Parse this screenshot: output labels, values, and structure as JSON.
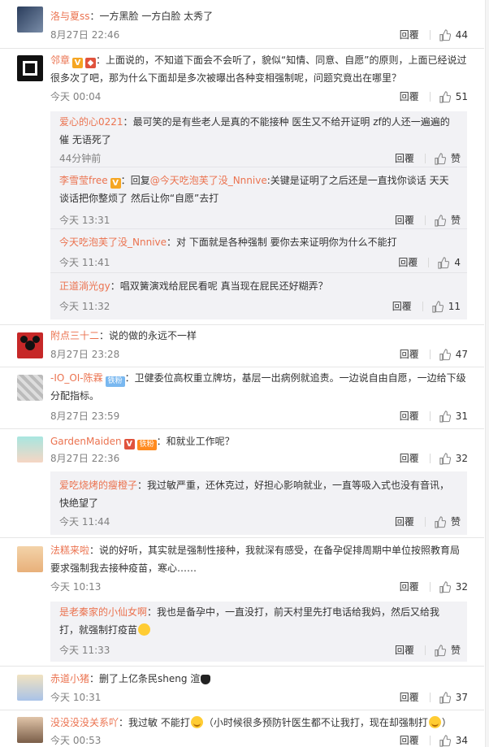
{
  "ui": {
    "reply_label": "回覆",
    "like_icon": "thumbs-up-icon",
    "accent_name_color": "#eb7350"
  },
  "comments": [
    {
      "user": "洛与夏ss",
      "colon": "：",
      "text": "一方黑脸  一方白脸  太秀了",
      "time": "8月27日 22:46",
      "likes": "44"
    },
    {
      "user": "邻章",
      "colon": "：",
      "text": "上面说的，不知道下面会不会听了，貌似“知情、同意、自愿”的原则，上面已经说过很多次了吧，那为什么下面却是多次被曝出各种变相强制呢，问题究竟出在哪里？",
      "time": "今天 00:04",
      "likes": "51",
      "replies": [
        {
          "user": "爱心的心0221",
          "colon": "：",
          "text": "最可笑的是有些老人是真的不能接种 医生又不给开证明 zf的人还一遍遍的催 无语死了",
          "time": "44分钟前",
          "likes": "赞"
        },
        {
          "user": "李雪莹free",
          "colon": "：",
          "prefix": "回复",
          "mention": "@今天吃泡芙了没_Nnnive",
          "text": ":关键是证明了之后还是一直找你谈话 天天谈话把你整烦了 然后让你“自愿”去打",
          "time": "今天 13:31",
          "likes": "赞"
        },
        {
          "user": "今天吃泡芙了没_Nnnive",
          "colon": "：",
          "text": "对  下面就是各种强制  要你去来证明你为什么不能打",
          "time": "今天 11:41",
          "likes": "4"
        },
        {
          "user": "正道淌光gy",
          "colon": "：",
          "text": "唱双簧演戏给屁民看呢  真当现在屁民还好糊弄？",
          "time": "今天 11:32",
          "likes": "11"
        }
      ]
    },
    {
      "user": "附点三十二",
      "colon": "：",
      "text": "说的做的永远不一样",
      "time": "8月27日 23:28",
      "likes": "47"
    },
    {
      "user": "-IO_OI-陈霖",
      "badge": "铁粉",
      "colon": "：",
      "text": "卫健委位高权重立牌坊，基层一出病例就追责。一边说自由自愿，一边给下级分配指标。",
      "time": "8月27日 23:59",
      "likes": "31"
    },
    {
      "user": "GardenMaiden",
      "badge": "铁粉",
      "colon": "：",
      "text": "和就业工作呢？",
      "time": "8月27日 22:36",
      "likes": "32",
      "replies": [
        {
          "user": "爱吃烧烤的瘦橙子",
          "colon": "：",
          "text": "我过敏严重，还休克过，好担心影响就业，一直等吸入式也没有音讯，快绝望了",
          "time": "今天 11:44",
          "likes": "赞"
        }
      ]
    },
    {
      "user": "法糕来啦",
      "colon": "：",
      "text": "说的好听，其实就是强制性接种，我就深有感受，在备孕促排周期中单位按照教育局要求强制我去接种疫苗，寒心……",
      "time": "今天 10:13",
      "likes": "32",
      "replies": [
        {
          "user": "是老秦家的小仙女啊",
          "colon": "：",
          "text": "我也是备孕中，一直没打，前天村里先打电话给我妈，然后又给我打，就强制打疫苗",
          "time": "今天 11:33",
          "likes": "赞"
        }
      ]
    },
    {
      "user": "赤道小猪",
      "colon": "：",
      "text": "删了上亿条民sheng 渲",
      "time": "今天 10:31",
      "likes": "37"
    },
    {
      "user": "没没没没关系吖",
      "colon": "：",
      "text": "我过敏 不能打",
      "text2": "（小时候很多预防针医生都不让我打，现在却强制打",
      "text3": "）",
      "time": "今天 00:53",
      "likes": "34"
    }
  ]
}
